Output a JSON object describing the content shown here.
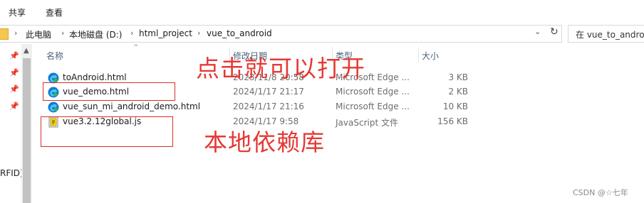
{
  "ribbon": {
    "tabs": [
      "共享",
      "查看"
    ]
  },
  "address": {
    "crumbs": [
      "此电脑",
      "本地磁盘 (D:)",
      "html_project",
      "vue_to_android"
    ],
    "separator": "›",
    "search_placeholder": "在 vue_to_android"
  },
  "nav": {
    "partial_label": "RFID)"
  },
  "headers": {
    "name": "名称",
    "date": "修改日期",
    "type": "类型",
    "size": "大小"
  },
  "files": [
    {
      "name": "toAndroid.html",
      "date": "2023/11/8 20:58",
      "type": "Microsoft Edge ...",
      "size": "3 KB",
      "icon": "edge-icon"
    },
    {
      "name": "vue_demo.html",
      "date": "2024/1/17 21:17",
      "type": "Microsoft Edge ...",
      "size": "2 KB",
      "icon": "edge-icon"
    },
    {
      "name": "vue_sun_mi_android_demo.html",
      "date": "2024/1/17 21:16",
      "type": "Microsoft Edge ...",
      "size": "10 KB",
      "icon": "edge-icon"
    },
    {
      "name": "vue3.2.12global.js",
      "date": "2024/1/17 9:58",
      "type": "JavaScript 文件",
      "size": "156 KB",
      "icon": "js-file-icon"
    }
  ],
  "annotations": {
    "open_note": "点击就可以打开",
    "lib_note": "本地依赖库"
  },
  "watermark": "CSDN @☆七年",
  "colors": {
    "annotation": "#e53935",
    "folder": "#f4c84f",
    "edge": "#0f7bd8"
  }
}
